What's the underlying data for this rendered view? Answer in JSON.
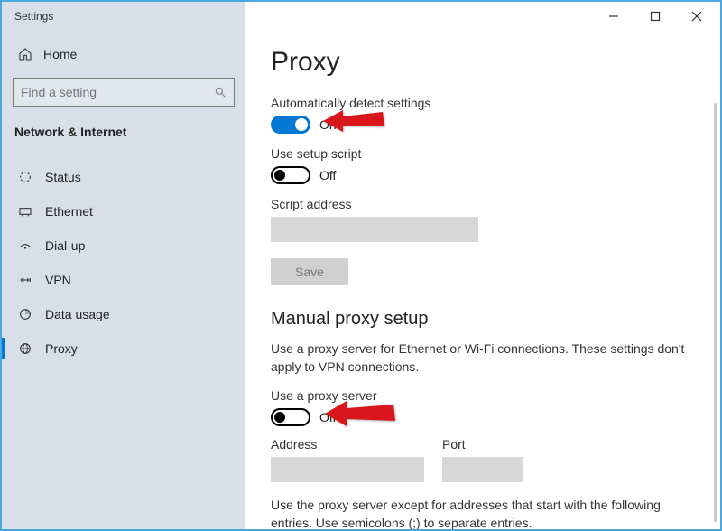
{
  "window": {
    "title": "Settings"
  },
  "sidebar": {
    "home": "Home",
    "search_placeholder": "Find a setting",
    "section": "Network & Internet",
    "items": [
      {
        "label": "Status"
      },
      {
        "label": "Ethernet"
      },
      {
        "label": "Dial-up"
      },
      {
        "label": "VPN"
      },
      {
        "label": "Data usage"
      },
      {
        "label": "Proxy"
      }
    ]
  },
  "content": {
    "title": "Proxy",
    "auto_detect": {
      "label": "Automatically detect settings",
      "state": "On"
    },
    "setup_script": {
      "label": "Use setup script",
      "state": "Off"
    },
    "script_address_label": "Script address",
    "save": "Save",
    "manual_heading": "Manual proxy setup",
    "manual_desc": "Use a proxy server for Ethernet or Wi-Fi connections. These settings don't apply to VPN connections.",
    "use_proxy": {
      "label": "Use a proxy server",
      "state": "Off"
    },
    "address_label": "Address",
    "port_label": "Port",
    "exceptions_desc": "Use the proxy server except for addresses that start with the following entries. Use semicolons (;) to separate entries."
  }
}
